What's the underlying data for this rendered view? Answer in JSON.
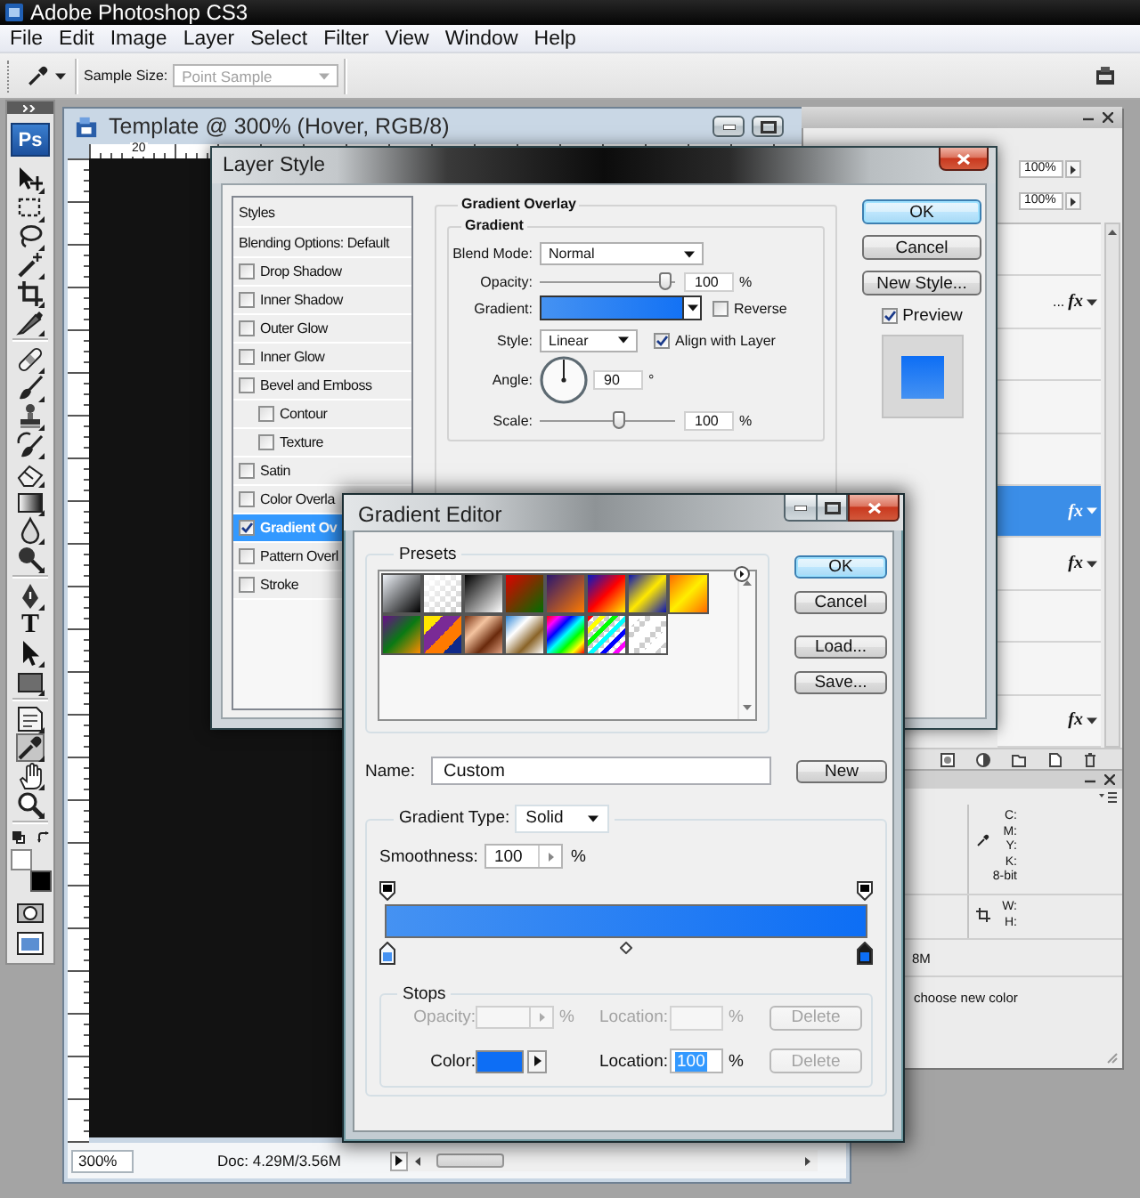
{
  "app": {
    "title": "Adobe Photoshop CS3",
    "logo": "Ps"
  },
  "menu": [
    "File",
    "Edit",
    "Image",
    "Layer",
    "Select",
    "Filter",
    "View",
    "Window",
    "Help"
  ],
  "options_bar": {
    "label": "Sample Size:",
    "value": "Point Sample",
    "disabled": true
  },
  "toolbox": {
    "tool_groups": [
      [
        {
          "kind": "move",
          "selected": false
        },
        {
          "kind": "marquee",
          "selected": false
        },
        {
          "kind": "lasso",
          "selected": false
        },
        {
          "kind": "wand",
          "selected": false
        },
        {
          "kind": "crop",
          "selected": false
        },
        {
          "kind": "knife",
          "selected": false
        }
      ],
      [
        {
          "kind": "bandage",
          "selected": false
        },
        {
          "kind": "brush",
          "selected": false
        },
        {
          "kind": "stamp",
          "selected": false
        },
        {
          "kind": "history",
          "selected": false
        },
        {
          "kind": "eraser",
          "selected": false
        },
        {
          "kind": "gradient",
          "selected": false
        },
        {
          "kind": "drop",
          "selected": false
        },
        {
          "kind": "dodge",
          "selected": false
        }
      ],
      [
        {
          "kind": "pen",
          "selected": false
        },
        {
          "kind": "type",
          "glyph": "T",
          "selected": false
        },
        {
          "kind": "pathselect",
          "selected": false
        },
        {
          "kind": "shape",
          "selected": false
        }
      ],
      [
        {
          "kind": "note",
          "selected": false
        },
        {
          "kind": "eyedropper",
          "selected": true
        },
        {
          "kind": "hand",
          "selected": false
        },
        {
          "kind": "zoom",
          "selected": false
        }
      ]
    ],
    "color_swatches": [
      {
        "kind": "foreground",
        "color": "#ffffff"
      },
      {
        "kind": "background",
        "color": "#000000"
      }
    ],
    "mode_tools": [
      {
        "kind": "quickmask"
      },
      {
        "kind": "screenmode"
      }
    ]
  },
  "document": {
    "title": "Template @ 300% (Hover, RGB/8)",
    "ruler_label": "20",
    "zoom": "300%",
    "info": "Doc: 4.29M/3.56M"
  },
  "layers_panel": {
    "opacity": "100%",
    "fill": "100%",
    "rows": [
      {
        "selected": false
      },
      {
        "text": "...",
        "fx": "fx",
        "selected": false
      },
      {
        "selected": false
      },
      {
        "selected": false
      },
      {
        "selected": false
      },
      {
        "fx": "fx",
        "selected": true
      },
      {
        "fx": "fx",
        "selected": false
      },
      {
        "selected": false
      },
      {
        "selected": false
      },
      {
        "fx": "fx",
        "selected": false
      }
    ]
  },
  "info_panel": {
    "color_readouts": [
      "C:",
      "M:",
      "Y:",
      "K:",
      "8-bit"
    ],
    "size_readouts": [
      "W:",
      "H:"
    ],
    "doc_size": "8M",
    "status": "choose new color"
  },
  "layer_style": {
    "title": "Layer Style",
    "sections": [
      {
        "label": "Styles",
        "selected": false
      },
      {
        "label": "Blending Options: Default",
        "selected": false
      }
    ],
    "effects": [
      {
        "label": "Drop Shadow",
        "checked": false,
        "selected": false
      },
      {
        "label": "Inner Shadow",
        "checked": false,
        "selected": false
      },
      {
        "label": "Outer Glow",
        "checked": false,
        "selected": false
      },
      {
        "label": "Inner Glow",
        "checked": false,
        "selected": false
      },
      {
        "label": "Bevel and Emboss",
        "checked": false,
        "selected": false,
        "children": [
          {
            "label": "Contour",
            "checked": false,
            "selected": false
          },
          {
            "label": "Texture",
            "checked": false,
            "selected": false
          }
        ]
      },
      {
        "label": "Satin",
        "checked": false,
        "selected": false
      },
      {
        "label": "Color Overla",
        "checked": false,
        "selected": false
      },
      {
        "label": "Gradient Ov",
        "checked": true,
        "selected": true
      },
      {
        "label": "Pattern Overl",
        "checked": false,
        "selected": false
      },
      {
        "label": "Stroke",
        "checked": false,
        "selected": false
      }
    ],
    "panel": {
      "title": "Gradient Overlay",
      "group": "Gradient",
      "blend_mode": {
        "label": "Blend Mode:",
        "value": "Normal"
      },
      "opacity": {
        "label": "Opacity:",
        "level": 0.97,
        "value": "100",
        "unit": "%"
      },
      "gradient": {
        "label": "Gradient:"
      },
      "reverse": {
        "label": "Reverse",
        "checked": false
      },
      "style": {
        "label": "Style:",
        "value": "Linear"
      },
      "align": {
        "label": "Align with Layer",
        "checked": true
      },
      "angle": {
        "label": "Angle:",
        "value": "90",
        "unit": "°"
      },
      "scale": {
        "label": "Scale:",
        "level": 0.6,
        "value": "100",
        "unit": "%"
      }
    },
    "buttons": [
      {
        "label": "OK",
        "default": true
      },
      {
        "label": "Cancel",
        "default": false
      },
      {
        "label": "New Style...",
        "default": false
      }
    ],
    "preview": {
      "label": "Preview",
      "checked": true
    }
  },
  "gradient_editor": {
    "title": "Gradient Editor",
    "presets_label": "Presets",
    "presets": [
      {
        "kind": "fgbg"
      },
      {
        "kind": "fade"
      },
      {
        "kind": "blackwhite"
      },
      {
        "kind": "redgreen"
      },
      {
        "kind": "violetorange"
      },
      {
        "kind": "blueredyellow"
      },
      {
        "kind": "blueyellowblue"
      },
      {
        "kind": "orangeyellow"
      },
      {
        "kind": "violetgreenorange"
      },
      {
        "kind": "stripes"
      },
      {
        "kind": "copper"
      },
      {
        "kind": "chrome"
      },
      {
        "kind": "spectrum"
      },
      {
        "kind": "rainbowfade"
      },
      {
        "kind": "clearstripes"
      }
    ],
    "buttons": [
      {
        "label": "OK",
        "default": true
      },
      {
        "label": "Cancel",
        "default": false
      },
      {
        "label": "Load...",
        "default": false
      },
      {
        "label": "Save...",
        "default": false
      }
    ],
    "name_label": "Name:",
    "name": "Custom",
    "new_button": "New",
    "type_label": "Gradient Type:",
    "type": "Solid",
    "smoothness_label": "Smoothness:",
    "smoothness": "100",
    "smoothness_unit": "%",
    "opacity_stops": [
      {
        "selected": false
      },
      {
        "selected": false
      }
    ],
    "color_stops": [
      {
        "color": "#4592f2",
        "selected": false
      },
      {
        "color": "#0d6ef5",
        "selected": true
      }
    ],
    "stops_label": "Stops",
    "stop_rows": [
      {
        "kind": "opacity",
        "label": "Opacity:",
        "unit": "%",
        "location_label": "Location:",
        "location_unit": "%",
        "delete": "Delete",
        "disabled": true,
        "delete_disabled": true
      },
      {
        "kind": "color",
        "label": "Color:",
        "location_label": "Location:",
        "location": "100",
        "location_unit": "%",
        "location_highlighted": true,
        "delete": "Delete",
        "disabled": false,
        "delete_disabled": true
      }
    ]
  }
}
